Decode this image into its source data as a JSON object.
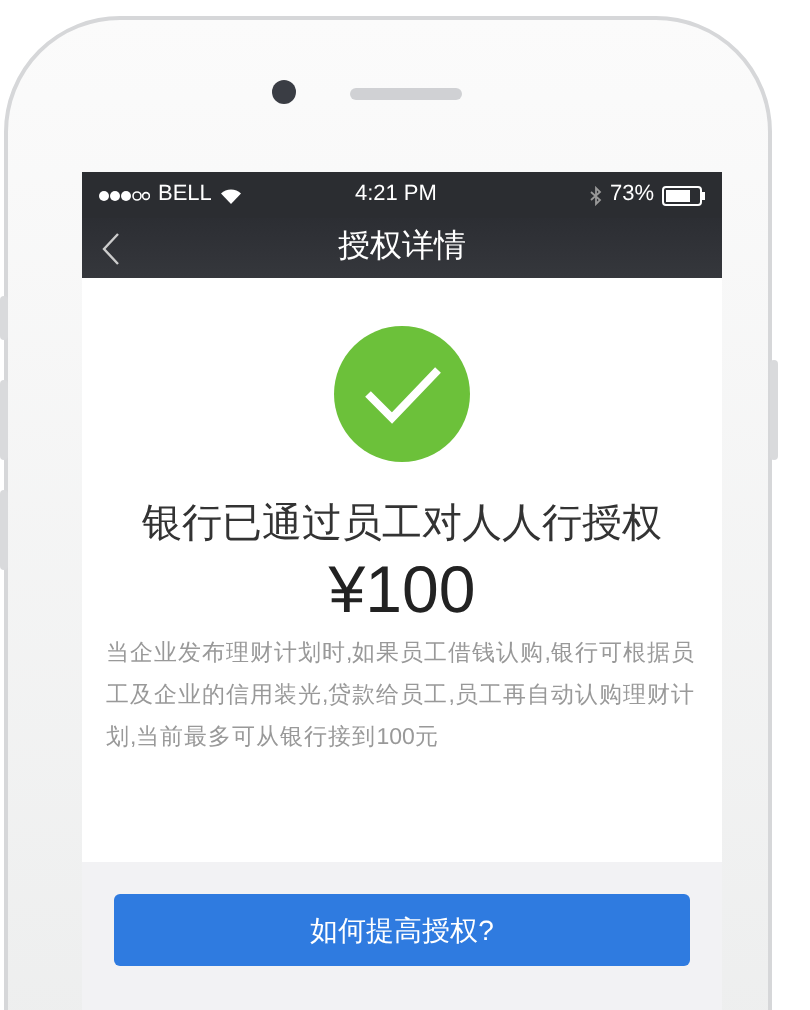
{
  "status_bar": {
    "carrier": "BELL",
    "time": "4:21 PM",
    "battery": "73%"
  },
  "nav_bar": {
    "title": "授权详情"
  },
  "result": {
    "heading": "银行已通过员工对人人行授权",
    "amount": "¥100",
    "description": "当企业发布理财计划时,如果员工借钱认购,银行可根据员工及企业的信用装光,贷款给员工,员工再自动认购理财计划,当前最多可从银行接到100元"
  },
  "button": {
    "label": "如何提高授权?"
  }
}
